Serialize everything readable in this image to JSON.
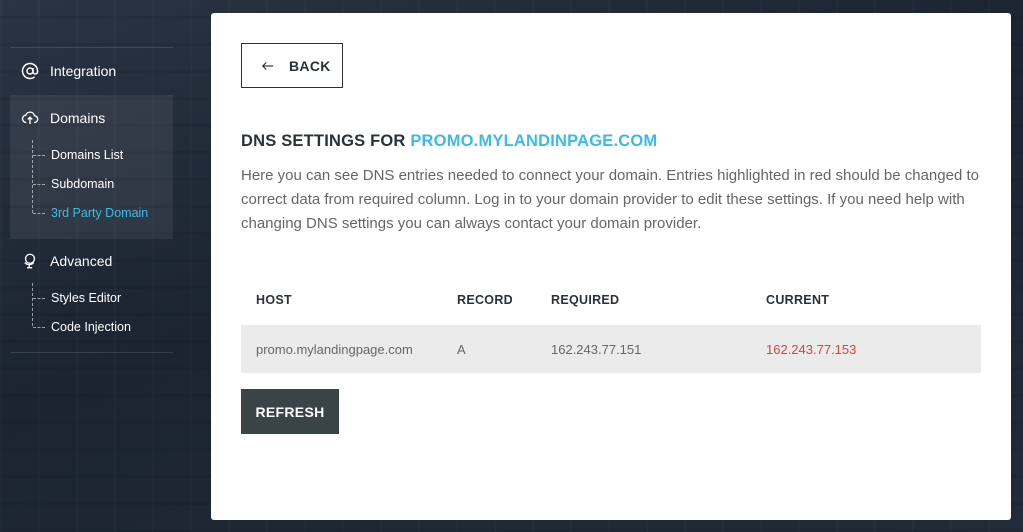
{
  "sidebar": {
    "integration": {
      "label": "Integration",
      "icon": "at-icon"
    },
    "domains": {
      "label": "Domains",
      "icon": "cloud-upload-icon",
      "items": [
        {
          "label": "Domains List",
          "active": false
        },
        {
          "label": "Subdomain",
          "active": false
        },
        {
          "label": "3rd Party Domain",
          "active": true
        }
      ]
    },
    "advanced": {
      "label": "Advanced",
      "icon": "globe-icon",
      "items": [
        {
          "label": "Styles Editor"
        },
        {
          "label": "Code Injection"
        }
      ]
    }
  },
  "panel": {
    "back_label": "BACK",
    "title_prefix": "DNS SETTINGS FOR",
    "title_domain": "PROMO.MYLANDINPAGE.COM",
    "description": "Here you can see DNS entries needed to connect your domain. Entries highlighted in red should be changed to correct data from required column. Log in to your domain provider to edit these settings. If you need help with changing DNS settings you can always contact your domain provider.",
    "table": {
      "headers": [
        "HOST",
        "RECORD",
        "REQUIRED",
        "CURRENT"
      ],
      "rows": [
        {
          "host": "promo.mylandingpage.com",
          "record": "A",
          "required": "162.243.77.151",
          "current": "162.243.77.153",
          "mismatch": true
        }
      ]
    },
    "refresh_label": "REFRESH"
  },
  "colors": {
    "accent": "#3cbbe8",
    "error": "#d04545",
    "button_dark": "#3a4446"
  }
}
